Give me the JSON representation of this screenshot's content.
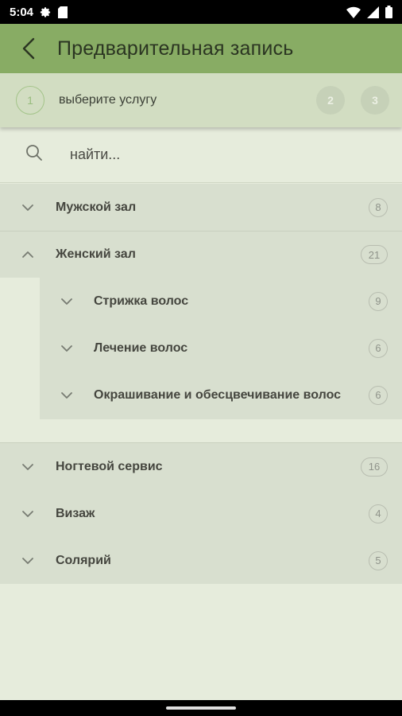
{
  "status_bar": {
    "time": "5:04",
    "icons": [
      "gear-icon",
      "sim-card-icon",
      "wifi-icon",
      "signal-icon",
      "battery-icon"
    ]
  },
  "app_bar": {
    "title": "Предварительная запись",
    "back_icon": "back-arrow-icon"
  },
  "steps": {
    "current": "1",
    "current_label": "выберите услугу",
    "next": [
      "2",
      "3"
    ]
  },
  "search": {
    "placeholder": "найти...",
    "icon": "search-icon"
  },
  "categories": [
    {
      "label": "Мужской зал",
      "count": "8",
      "expanded": false
    },
    {
      "label": "Женский зал",
      "count": "21",
      "expanded": true,
      "children": [
        {
          "label": "Стрижка волос",
          "count": "9"
        },
        {
          "label": "Лечение волос",
          "count": "6"
        },
        {
          "label": "Окрашивание и обесцвечивание волос",
          "count": "6"
        }
      ]
    },
    {
      "label": "Ногтевой сервис",
      "count": "16",
      "expanded": false
    },
    {
      "label": "Визаж",
      "count": "4",
      "expanded": false
    },
    {
      "label": "Солярий",
      "count": "5",
      "expanded": false
    }
  ],
  "colors": {
    "app_bar": "#88ac64",
    "steps_bg": "#d2ddc2",
    "page_bg": "#e6ecdc",
    "row_bg": "#d8dfcf"
  }
}
